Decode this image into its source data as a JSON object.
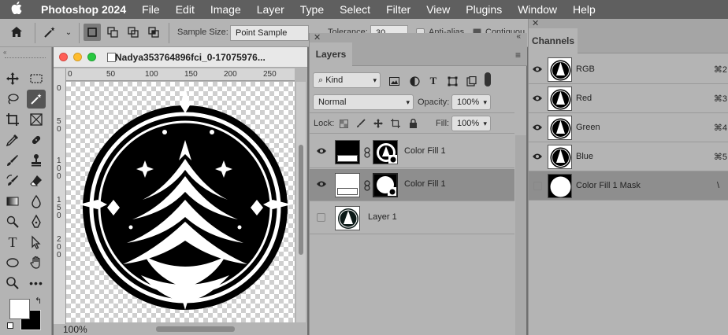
{
  "menubar": {
    "apple_icon": "apple-logo-icon",
    "items": [
      "Photoshop 2024",
      "File",
      "Edit",
      "Image",
      "Layer",
      "Type",
      "Select",
      "Filter",
      "View",
      "Plugins",
      "Window",
      "Help"
    ]
  },
  "options": {
    "sample_size_label": "Sample Size:",
    "sample_size_value": "Point Sample",
    "tolerance_label": "Tolerance:",
    "tolerance_value": "30",
    "anti_alias_label": "Anti-alias",
    "contiguous_label": "Contiguous"
  },
  "toolbar": {
    "foreground_color": "#ffffff",
    "background_color": "#000000"
  },
  "document": {
    "title": "Nadya353764896fci_0-17075976...",
    "ruler_top": [
      "0",
      "50",
      "100",
      "150",
      "200",
      "250"
    ],
    "ruler_left": [
      "0",
      "5",
      "0",
      "1",
      "0",
      "0",
      "1",
      "5",
      "0",
      "2",
      "0",
      "0"
    ],
    "zoom": "100%"
  },
  "layers_panel": {
    "tab": "Layers",
    "filter_kind": "Kind",
    "blend_mode": "Normal",
    "opacity_label": "Opacity:",
    "opacity_value": "100%",
    "lock_label": "Lock:",
    "fill_label": "Fill:",
    "fill_value": "100%",
    "layers": [
      {
        "name": "Color Fill 1",
        "visible": true,
        "selected": false
      },
      {
        "name": "Color Fill 1",
        "visible": true,
        "selected": true
      },
      {
        "name": "Layer 1",
        "visible": false,
        "selected": false
      }
    ]
  },
  "channels_panel": {
    "tab": "Channels",
    "channels": [
      {
        "name": "RGB",
        "shortcut": "⌘2",
        "visible": true
      },
      {
        "name": "Red",
        "shortcut": "⌘3",
        "visible": true
      },
      {
        "name": "Green",
        "shortcut": "⌘4",
        "visible": true
      },
      {
        "name": "Blue",
        "shortcut": "⌘5",
        "visible": true
      },
      {
        "name": "Color Fill 1 Mask",
        "shortcut": "\\",
        "visible": false
      }
    ]
  }
}
